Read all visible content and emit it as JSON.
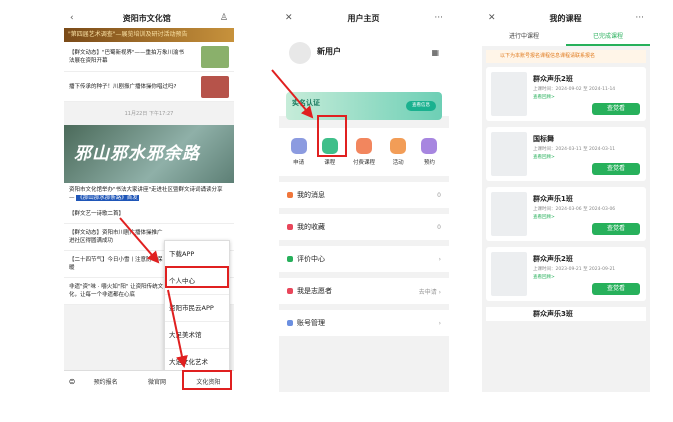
{
  "phone1": {
    "nav_title": "资阳市文化馆",
    "banner_text": "\"第四届艺术调查\"—展览培训及研讨活动预告",
    "news": [
      {
        "text": "【群文动态】\"巴蜀新视界\"——重拍万象川渝书法展在资阳开幕"
      },
      {
        "text": "播下传承的种子！川剧振广播体操你唱过吗?"
      }
    ],
    "timestamp": "11月22日 下午17:27",
    "calligraphy": "邪山邪水邪余路",
    "caption_text": "资阳市文化馆举办\"书法大家讲座\"走进社区暨群文诗词诵读分享 —",
    "caption_highlight": "《那山那水那条路》首发",
    "items": [
      "【群文艺一诗歌二首】",
      "【群文动态】资阳市川剧广播体操推广进社区得圆满成功",
      "【二十四节气】今日小雪丨注意防寒保暖",
      "非遗\"资\"味 · 嚼火如\"阳\" 让资阳传统文化，让每一个非遗都在心底"
    ],
    "popup_menu": [
      "下载APP",
      "个人中心",
      "资阳市民云APP",
      "大足美术馆",
      "大足文化艺术"
    ],
    "tabbar": [
      "预约报名",
      "微官网",
      "文化资阳"
    ]
  },
  "phone2": {
    "nav_title": "用户主页",
    "username": "新用户",
    "cert_title": "实名认证",
    "cert_button": "查看信息",
    "icons": [
      {
        "label": "申请",
        "color": "#8c9be0"
      },
      {
        "label": "课程",
        "color": "#3fbf8a"
      },
      {
        "label": "付费课程",
        "color": "#f2865e"
      },
      {
        "label": "活动",
        "color": "#f29d57"
      },
      {
        "label": "预约",
        "color": "#a786e0"
      }
    ],
    "list": [
      {
        "label": "我的消息",
        "value": "0",
        "color": "#f0763b"
      },
      {
        "label": "我的收藏",
        "value": "0",
        "color": "#e8465a"
      },
      {
        "label": "评价中心",
        "value": "›",
        "color": "#27b05b"
      },
      {
        "label": "我是志愿者",
        "value": "去申请 ›",
        "color": "#e8465a"
      },
      {
        "label": "账号管理",
        "value": "›",
        "color": "#6b8fe0"
      }
    ]
  },
  "phone3": {
    "nav_title": "我的课程",
    "tabs": [
      "进行中课程",
      "已完成课程"
    ],
    "notice": "以下为本账号报名课程信息课程请联系报名",
    "cards": [
      {
        "title": "群众声乐2班",
        "time": "上课时间：2024-09-02 至 2024-11-14",
        "link": "查看回顾> ",
        "button": "查觉看"
      },
      {
        "title": "国标舞",
        "time": "上课时间：2024-03-11 至 2024-03-11",
        "link": "查看回顾> ",
        "button": "查觉看"
      },
      {
        "title": "群众声乐1班",
        "time": "上课时间：2024-03-06 至 2024-03-06",
        "link": "查看回顾> ",
        "button": "查觉看"
      },
      {
        "title": "群众声乐2班",
        "time": "上课时间：2023-09-21 至 2023-09-21",
        "link": "查看回顾> ",
        "button": "查觉看"
      }
    ],
    "last_title": "群众声乐3班"
  }
}
